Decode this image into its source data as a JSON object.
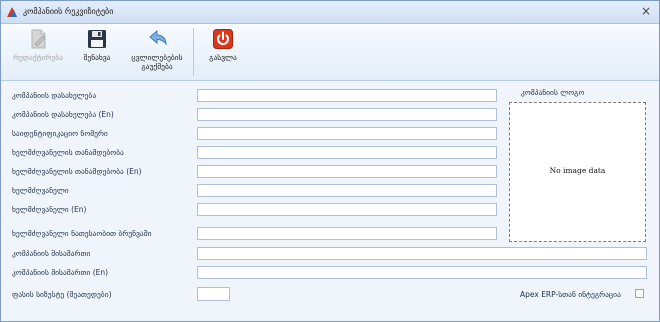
{
  "window": {
    "title": "კომპანიის რეკვიზიტები",
    "close_glyph": "×"
  },
  "toolbar": {
    "edit_label": "რედაქტირება",
    "save_label": "შენახვა",
    "cancel_label_line1": "ცვლილებების",
    "cancel_label_line2": "გაუქმება",
    "exit_label": "გასვლა"
  },
  "form": {
    "fields": [
      {
        "label": "კომპანიის დასახელება",
        "value": ""
      },
      {
        "label": "კომპანიის დასახელება (En)",
        "value": ""
      },
      {
        "label": "საიდენტიფიკაციო ნომერი",
        "value": ""
      },
      {
        "label": "ხელმძღვანელის თანამდებობა",
        "value": ""
      },
      {
        "label": "ხელმძღვანელის თანამდებობა (En)",
        "value": ""
      },
      {
        "label": "ხელმძღვანელი",
        "value": ""
      },
      {
        "label": "ხელმძღვანელი (En)",
        "value": ""
      },
      {
        "label": "ხელმძღვანელი ნათესაობით ბრუნვაში",
        "value": ""
      },
      {
        "label": "კომპანიის მისამართი",
        "value": ""
      },
      {
        "label": "კომპანიის მისამართი (En)",
        "value": ""
      },
      {
        "label": "ფასის სიზუსტე (მეათედები)",
        "value": ""
      }
    ]
  },
  "logo": {
    "title": "კომპანიის ლოგო",
    "placeholder": "No image data"
  },
  "apex": {
    "label": "Apex ERP-სთან ინტეგრაცია",
    "checked": false
  },
  "colors": {
    "accent": "#d9381e",
    "window_bg": "#f0f5fb",
    "border": "#7e9dc4"
  }
}
